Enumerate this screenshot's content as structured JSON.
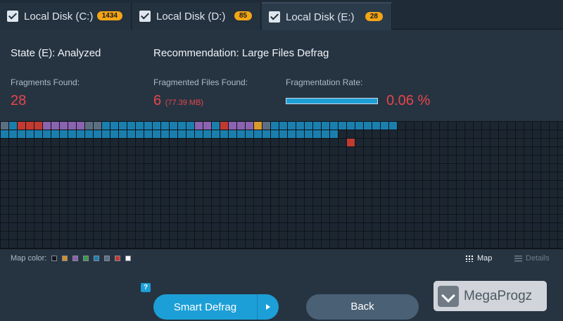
{
  "tabs": [
    {
      "label": "Local Disk (C:)",
      "badge": "1434",
      "active": false
    },
    {
      "label": "Local Disk (D:)",
      "badge": "85",
      "active": false
    },
    {
      "label": "Local Disk (E:)",
      "badge": "28",
      "active": true
    }
  ],
  "info": {
    "state": "State (E): Analyzed",
    "recommendation": "Recommendation: Large Files Defrag",
    "fragments_label": "Fragments Found:",
    "fragments_value": "28",
    "files_label": "Fragmented Files Found:",
    "files_value": "6",
    "files_size": "(77.39 MB)",
    "rate_label": "Fragmentation Rate:",
    "rate_value": "0.06 %",
    "rate_fill": 1.0
  },
  "map": {
    "colors": {
      "empty": "#1c2631",
      "blue": "#1b7fae",
      "slate": "#5c6f82",
      "red": "#c33a30",
      "purple": "#8b63b0",
      "orange": "#d79a2b"
    },
    "row1": [
      "slate",
      "blue",
      "red",
      "red",
      "red",
      "purple",
      "purple",
      "purple",
      "purple",
      "purple",
      "slate",
      "slate",
      "blue",
      "blue",
      "blue",
      "blue",
      "blue",
      "blue",
      "blue",
      "blue",
      "blue",
      "blue",
      "blue",
      "purple",
      "purple",
      "blue",
      "red",
      "purple",
      "purple",
      "purple",
      "orange",
      "slate",
      "blue",
      "blue",
      "blue",
      "blue",
      "blue",
      "blue",
      "blue",
      "blue",
      "blue",
      "blue",
      "blue",
      "blue",
      "blue",
      "blue",
      "blue"
    ],
    "row2": [
      "blue",
      "blue",
      "blue",
      "blue",
      "blue",
      "blue",
      "blue",
      "blue",
      "blue",
      "blue",
      "blue",
      "blue",
      "blue",
      "blue",
      "blue",
      "blue",
      "blue",
      "blue",
      "blue",
      "blue",
      "blue",
      "blue",
      "blue",
      "blue",
      "blue",
      "blue",
      "blue",
      "blue",
      "blue",
      "blue",
      "blue",
      "blue",
      "blue",
      "blue",
      "blue",
      "blue",
      "blue",
      "blue",
      "blue",
      "blue"
    ],
    "row3_red_col": 41
  },
  "legend": {
    "label": "Map color:",
    "swatches": [
      "#111922",
      "#d08f23",
      "#8a5fb0",
      "#3a9a4a",
      "#1b7fae",
      "#5c6f82",
      "#c33a30",
      "#ffffff"
    ]
  },
  "view": {
    "map_label": "Map",
    "details_label": "Details"
  },
  "buttons": {
    "smart_defrag": "Smart Defrag",
    "back": "Back",
    "help": "?"
  },
  "watermark": "MegaProgz"
}
